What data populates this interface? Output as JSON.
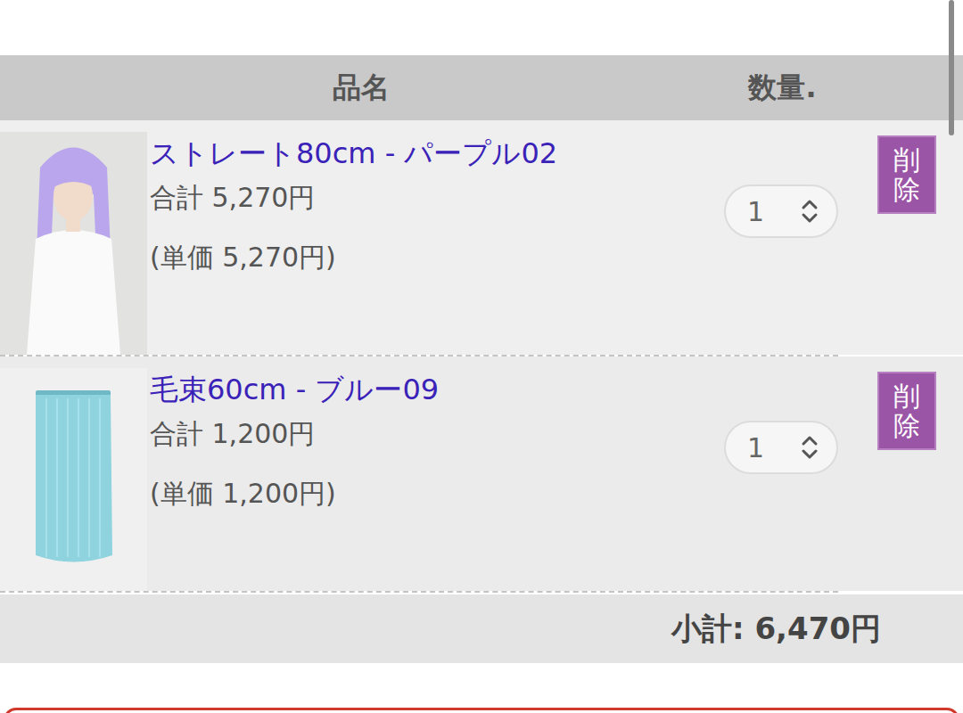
{
  "header": {
    "columns": [
      "品名",
      "数量."
    ]
  },
  "items": [
    {
      "name": "ストレート80cm - パープル02",
      "total": "合計 5,270円",
      "unit_price": "(単価 5,270円)",
      "quantity": "1",
      "delete_label": "削除",
      "kind": "wig",
      "color": "#b9a6ec"
    },
    {
      "name": "毛束60cm - ブルー09",
      "total": "合計 1,200円",
      "unit_price": "(単価 1,200円)",
      "quantity": "1",
      "delete_label": "削除",
      "kind": "extension",
      "color": "#8fd3de"
    }
  ],
  "subtotal": "小計: 6,470円"
}
